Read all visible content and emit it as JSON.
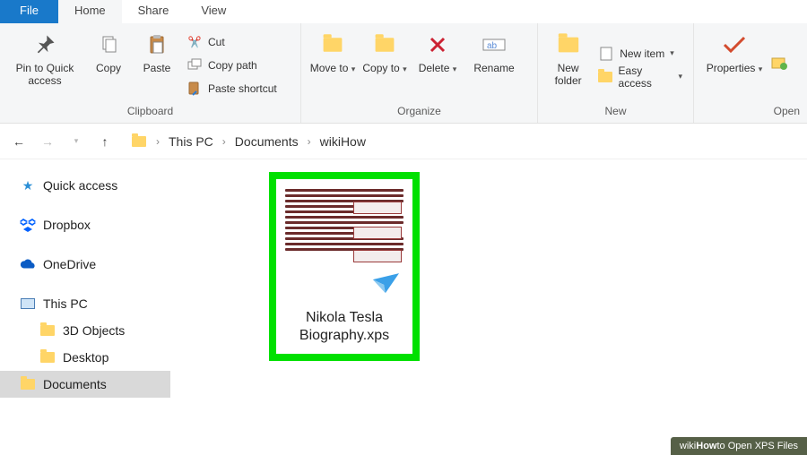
{
  "tabs": {
    "file": "File",
    "home": "Home",
    "share": "Share",
    "view": "View"
  },
  "ribbon": {
    "clipboard_label": "Clipboard",
    "organize_label": "Organize",
    "new_label": "New",
    "open_label": "Open",
    "pin_quick": "Pin to Quick access",
    "copy": "Copy",
    "paste": "Paste",
    "cut": "Cut",
    "copy_path": "Copy path",
    "paste_shortcut": "Paste shortcut",
    "move_to": "Move to",
    "copy_to": "Copy to",
    "delete": "Delete",
    "rename": "Rename",
    "new_folder": "New folder",
    "new_item": "New item",
    "easy_access": "Easy access",
    "properties": "Properties"
  },
  "breadcrumbs": {
    "root": "This PC",
    "a": "Documents",
    "b": "wikiHow"
  },
  "sidebar": {
    "quick_access": "Quick access",
    "dropbox": "Dropbox",
    "onedrive": "OneDrive",
    "this_pc": "This PC",
    "three_d": "3D Objects",
    "desktop": "Desktop",
    "documents": "Documents"
  },
  "file": {
    "name_line1": "Nikola Tesla",
    "name_line2": "Biography.xps"
  },
  "footer": {
    "brand1": "wiki",
    "brand2": "How",
    "rest": " to Open XPS Files"
  }
}
